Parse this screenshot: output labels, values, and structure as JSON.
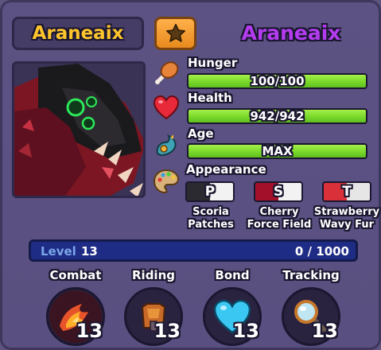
{
  "creature": {
    "name": "Araneaix",
    "species": "Araneaix"
  },
  "stats": {
    "hunger": {
      "label": "Hunger",
      "value": "100/100",
      "fill": 1.0
    },
    "health": {
      "label": "Health",
      "value": "942/942",
      "fill": 1.0
    },
    "age": {
      "label": "Age",
      "value": "MAX",
      "fill": 1.0
    }
  },
  "appearance": {
    "label": "Appearance",
    "items": [
      {
        "letter": "P",
        "line1": "Scoria",
        "line2": "Patches",
        "left_color": "#2a2a30",
        "right_color": "#f2f2f2"
      },
      {
        "letter": "S",
        "line1": "Cherry",
        "line2": "Force Field",
        "left_color": "#a3102a",
        "right_color": "#f2f2f2"
      },
      {
        "letter": "T",
        "line1": "Strawberry",
        "line2": "Wavy Fur",
        "left_color": "#d9303a",
        "right_color": "#e6e6e6"
      }
    ]
  },
  "level": {
    "label": "Level",
    "value": "13",
    "xp": "0 / 1000",
    "fill": 0.0
  },
  "skills": [
    {
      "label": "Combat",
      "level": "13",
      "icon": "combat-icon"
    },
    {
      "label": "Riding",
      "level": "13",
      "icon": "saddle-icon"
    },
    {
      "label": "Bond",
      "level": "13",
      "icon": "heart-icon"
    },
    {
      "label": "Tracking",
      "level": "13",
      "icon": "magnifier-icon"
    }
  ],
  "colors": {
    "hunger_icon": "#e8843a",
    "bar_fill": "#7ad82b",
    "level_bar": "#1f2c86",
    "species_text": "#b43cf0",
    "name_text": "#ffc52c"
  }
}
